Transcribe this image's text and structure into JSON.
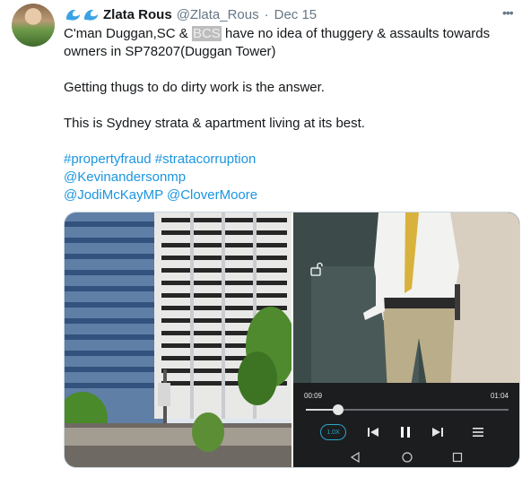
{
  "tweet": {
    "author_name": "Zlata Rous",
    "handle": "@Zlata_Rous",
    "separator": "·",
    "date": "Dec 15",
    "more_label": "•••",
    "line1_pre": "C'man Duggan,SC & ",
    "line1_highlight": "BCS",
    "line1_post": " have no idea of thuggery & assaults towards owners in SP78207(Duggan Tower)",
    "line2": "Getting thugs to do dirty work is the answer.",
    "line3": "This is Sydney strata & apartment living at its best.",
    "hashtags": "#propertyfraud #stratacorruption",
    "mention1": "@Kevinandersonmp",
    "mention2": "@JodiMcKayMP",
    "mention3": "@CloverMoore"
  },
  "video_player": {
    "current_time": "00:09",
    "total_time": "01:04",
    "progress_fraction": 0.16,
    "speed_label": "1.0X"
  },
  "icons": {
    "emoji": "water-wave-icon",
    "more": "more-horizontal-icon",
    "lock": "unlock-icon",
    "previous": "skip-previous-icon",
    "pause": "pause-icon",
    "next": "skip-next-icon",
    "menu": "menu-icon"
  },
  "colors": {
    "link": "#1b95e0",
    "secondary_text": "#657786",
    "player_accent": "#2aa6c8"
  }
}
